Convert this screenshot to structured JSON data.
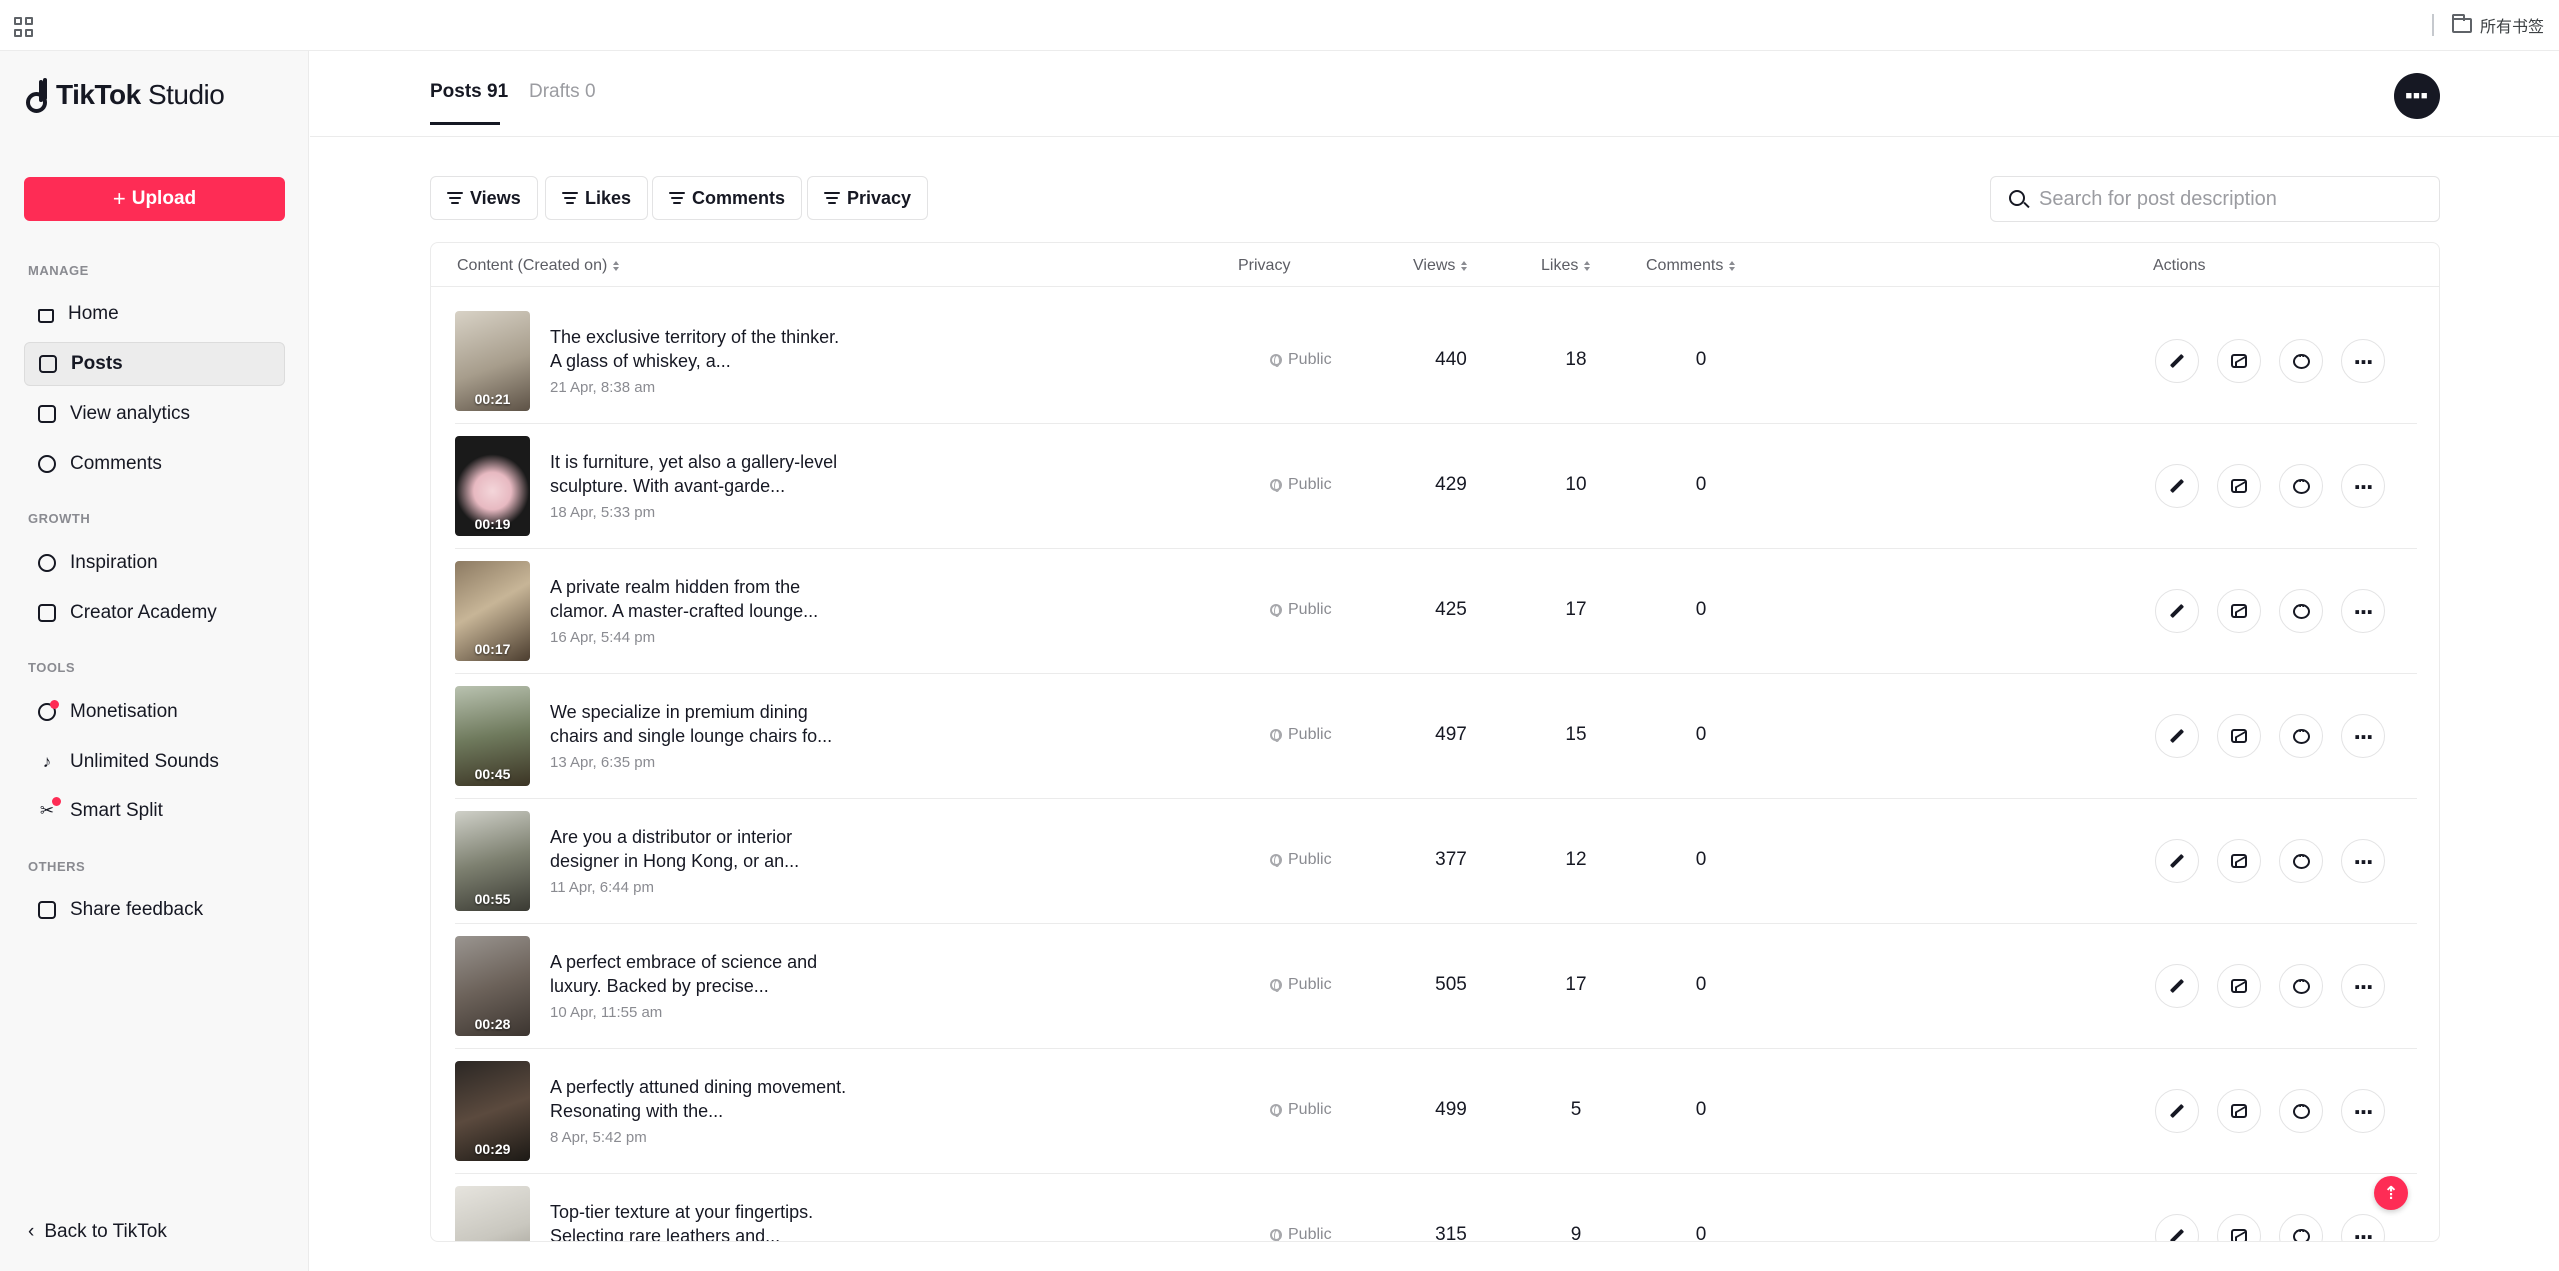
{
  "bookmarks_bar": {
    "folder_label": "所有书签"
  },
  "brand": {
    "name": "TikTok",
    "suffix": "Studio"
  },
  "sidebar": {
    "upload_label": "Upload",
    "sections": {
      "manage": "MANAGE",
      "growth": "GROWTH",
      "tools": "TOOLS",
      "others": "OTHERS"
    },
    "items": {
      "home": "Home",
      "posts": "Posts",
      "analytics": "View analytics",
      "comments": "Comments",
      "inspiration": "Inspiration",
      "academy": "Creator Academy",
      "monetisation": "Monetisation",
      "sounds": "Unlimited Sounds",
      "split": "Smart Split",
      "feedback": "Share feedback"
    },
    "back_label": "Back to TikTok",
    "active": "posts"
  },
  "tabs": {
    "posts": "Posts 91",
    "drafts": "Drafts 0"
  },
  "avatar_text": "■■■",
  "filters": {
    "views": "Views",
    "likes": "Likes",
    "comments": "Comments",
    "privacy": "Privacy"
  },
  "search": {
    "placeholder": "Search for post description"
  },
  "table": {
    "headers": {
      "content": "Content (Created on)",
      "privacy": "Privacy",
      "views": "Views",
      "likes": "Likes",
      "comments": "Comments",
      "actions": "Actions"
    },
    "rows": [
      {
        "title": "The exclusive territory of the thinker. A glass of whiskey, a...",
        "date": "21 Apr, 8:38 am",
        "duration": "00:21",
        "privacy": "Public",
        "views": "440",
        "likes": "18",
        "comments": "0"
      },
      {
        "title": "It is furniture, yet also a gallery-level sculpture. With avant-garde...",
        "date": "18 Apr, 5:33 pm",
        "duration": "00:19",
        "privacy": "Public",
        "views": "429",
        "likes": "10",
        "comments": "0"
      },
      {
        "title": "A private realm hidden from the clamor. A master-crafted lounge...",
        "date": "16 Apr, 5:44 pm",
        "duration": "00:17",
        "privacy": "Public",
        "views": "425",
        "likes": "17",
        "comments": "0"
      },
      {
        "title": "We specialize in premium dining chairs and single lounge chairs fo...",
        "date": "13 Apr, 6:35 pm",
        "duration": "00:45",
        "privacy": "Public",
        "views": "497",
        "likes": "15",
        "comments": "0"
      },
      {
        "title": "Are you a distributor or interior designer in Hong Kong, or an...",
        "date": "11 Apr, 6:44 pm",
        "duration": "00:55",
        "privacy": "Public",
        "views": "377",
        "likes": "12",
        "comments": "0"
      },
      {
        "title": "A perfect embrace of science and luxury. Backed by precise...",
        "date": "10 Apr, 11:55 am",
        "duration": "00:28",
        "privacy": "Public",
        "views": "505",
        "likes": "17",
        "comments": "0"
      },
      {
        "title": "A perfectly attuned dining movement. Resonating with the...",
        "date": "8 Apr, 5:42 pm",
        "duration": "00:29",
        "privacy": "Public",
        "views": "499",
        "likes": "5",
        "comments": "0"
      },
      {
        "title": "Top-tier texture at your fingertips. Selecting rare leathers and...",
        "date": "",
        "duration": "",
        "privacy": "Public",
        "views": "315",
        "likes": "9",
        "comments": "0"
      }
    ]
  },
  "colors": {
    "accent": "#fe2c55",
    "text": "#161823",
    "muted": "#8a8b91"
  }
}
